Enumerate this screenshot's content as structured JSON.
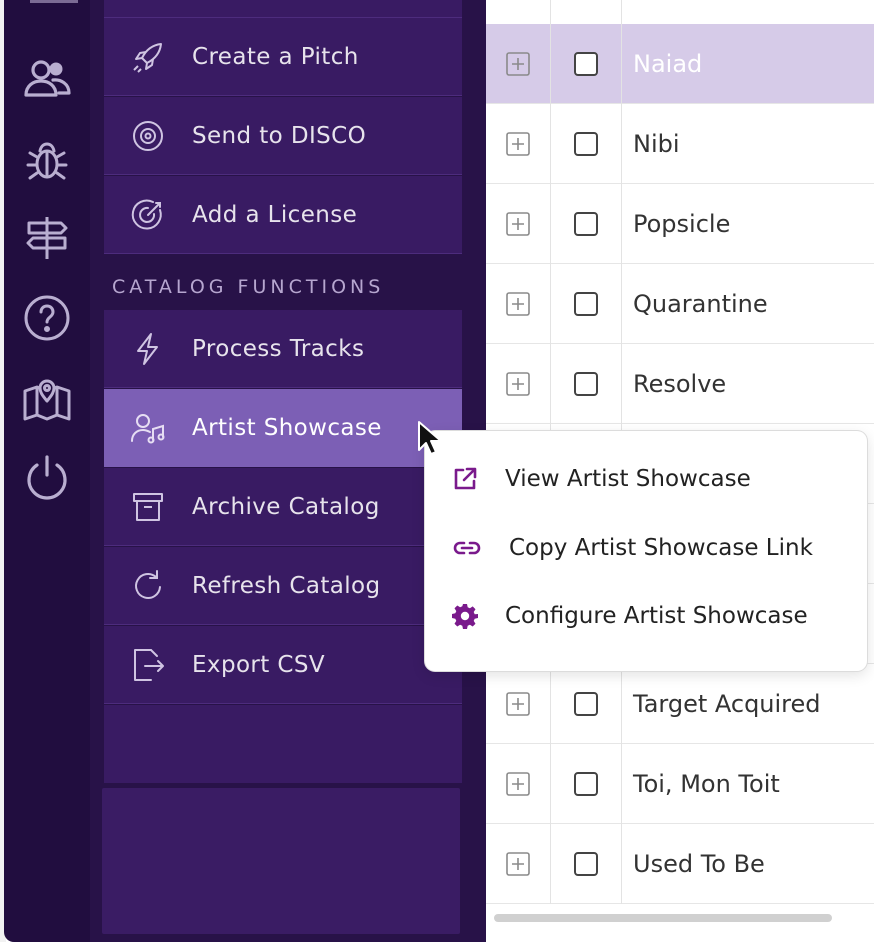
{
  "sidebar_rail": {
    "icons": [
      "users-icon",
      "bug-icon",
      "signpost-icon",
      "help-icon",
      "map-icon",
      "power-icon"
    ]
  },
  "menu": {
    "items_top": [
      {
        "label": "Create a Pitch",
        "icon": "rocket-icon"
      },
      {
        "label": "Send to DISCO",
        "icon": "disc-icon"
      },
      {
        "label": "Add a License",
        "icon": "target-icon"
      }
    ],
    "section_title": "CATALOG FUNCTIONS",
    "items_catalog": [
      {
        "label": "Process Tracks",
        "icon": "bolt-icon"
      },
      {
        "label": "Artist Showcase",
        "icon": "artist-music-icon",
        "active": true
      },
      {
        "label": "Archive Catalog",
        "icon": "archive-icon"
      },
      {
        "label": "Refresh Catalog",
        "icon": "refresh-icon"
      },
      {
        "label": "Export CSV",
        "icon": "export-icon"
      }
    ]
  },
  "table": {
    "rows": [
      {
        "name": "Naiad",
        "selected": true
      },
      {
        "name": "Nibi"
      },
      {
        "name": "Popsicle"
      },
      {
        "name": "Quarantine"
      },
      {
        "name": "Resolve"
      },
      {
        "name": ""
      },
      {
        "name": ""
      },
      {
        "name": ""
      },
      {
        "name": "Target Acquired"
      },
      {
        "name": "Toi, Mon Toit"
      },
      {
        "name": "Used To Be"
      }
    ]
  },
  "popup": {
    "items": [
      {
        "label": "View Artist Showcase",
        "icon": "external-link-icon"
      },
      {
        "label": "Copy Artist Showcase Link",
        "icon": "link-icon"
      },
      {
        "label": "Configure Artist Showcase",
        "icon": "gear-icon"
      }
    ]
  },
  "colors": {
    "rail_bg": "#210d3f",
    "panel_bg": "#281248",
    "item_bg": "#391b63",
    "item_active_bg": "#7c5fb5",
    "row_selected_bg": "#d6cbe8",
    "popup_icon": "#7a1a8c"
  }
}
